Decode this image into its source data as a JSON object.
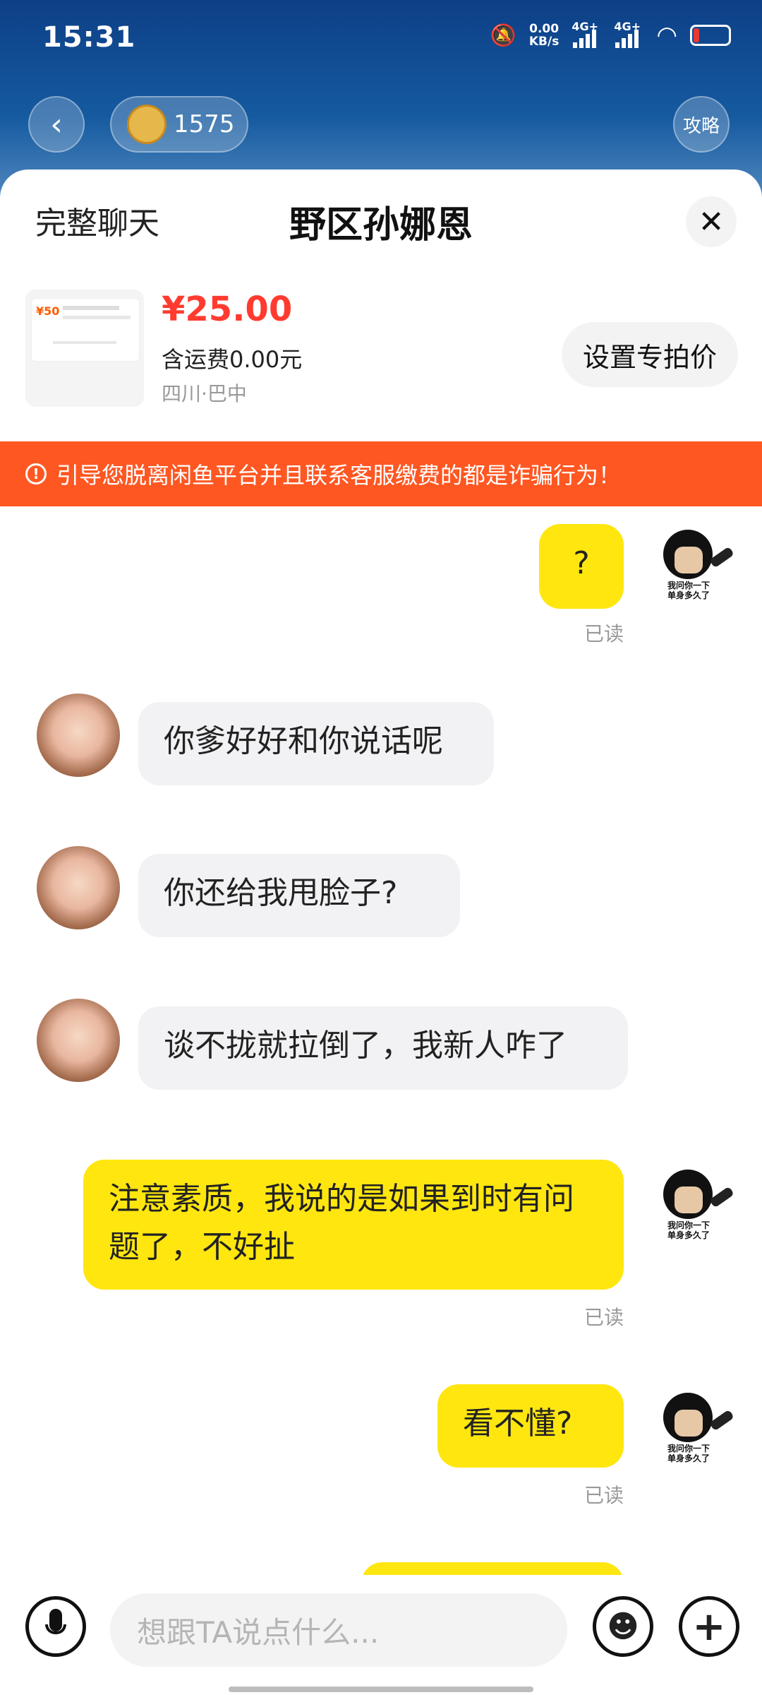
{
  "status_bar": {
    "time": "15:31",
    "net_speed": "0.00",
    "net_unit": "KB/s",
    "signal1": "4G+",
    "signal2": "4G+"
  },
  "game_bar": {
    "coins": "1575",
    "guide_label": "攻略"
  },
  "header": {
    "full_chat": "完整聊天",
    "title": "野区孙娜恩",
    "close": "✕"
  },
  "product": {
    "price": "¥25.00",
    "shipping": "含运费0.00元",
    "location": "四川·巴中",
    "thumb_tag": "¥50",
    "special_price_button": "设置专拍价"
  },
  "warning": {
    "text": "引导您脱离闲鱼平台并且联系客服缴费的都是诈骗行为！"
  },
  "messages": [
    {
      "from": "me",
      "text": "?",
      "read": "已读"
    },
    {
      "from": "them",
      "text": "你爹好好和你说话呢"
    },
    {
      "from": "them",
      "text": "你还给我甩脸子?"
    },
    {
      "from": "them",
      "text": "谈不拢就拉倒了，我新人咋了"
    },
    {
      "from": "me",
      "text": "注意素质，我说的是如果到时有问题了，不好扯",
      "read": "已读"
    },
    {
      "from": "me",
      "text": "看不懂?",
      "read": "已读"
    }
  ],
  "meme_caption": "我问你一下\n单身多久了",
  "input": {
    "placeholder": "想跟TA说点什么..."
  }
}
